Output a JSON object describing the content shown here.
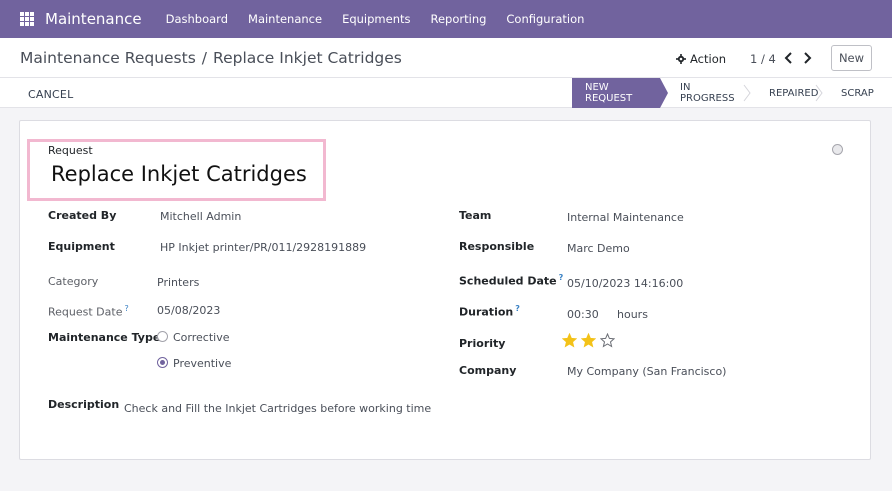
{
  "navbar": {
    "app_title": "Maintenance",
    "apps_icon": "grid-icon",
    "menu": [
      "Dashboard",
      "Maintenance",
      "Equipments",
      "Reporting",
      "Configuration"
    ]
  },
  "control_panel": {
    "breadcrumb_parent": "Maintenance Requests",
    "breadcrumb_separator": "/",
    "breadcrumb_current": "Replace Inkjet Catridges",
    "action_label": "Action",
    "pager": "1 / 4",
    "new_label": "New"
  },
  "statusbar": {
    "cancel_label": "CANCEL",
    "stages": [
      {
        "label": "NEW REQUEST",
        "active": true
      },
      {
        "label": "IN PROGRESS",
        "active": false
      },
      {
        "label": "REPAIRED",
        "active": false
      },
      {
        "label": "SCRAP",
        "active": false
      }
    ]
  },
  "form": {
    "request_label": "Request",
    "request_title": "Replace Inkjet Catridges",
    "left": {
      "created_by_label": "Created By",
      "created_by": "Mitchell Admin",
      "equipment_label": "Equipment",
      "equipment": "HP Inkjet printer/PR/011/2928191889",
      "category_label": "Category",
      "category": "Printers",
      "request_date_label": "Request Date",
      "request_date": "05/08/2023",
      "maintenance_type_label": "Maintenance Type",
      "types": [
        {
          "label": "Corrective",
          "checked": false
        },
        {
          "label": "Preventive",
          "checked": true
        }
      ]
    },
    "right": {
      "team_label": "Team",
      "team": "Internal Maintenance",
      "responsible_label": "Responsible",
      "responsible": "Marc Demo",
      "scheduled_date_label": "Scheduled Date",
      "scheduled_date": "05/10/2023 14:16:00",
      "duration_label": "Duration",
      "duration": "00:30",
      "duration_unit": "hours",
      "priority_label": "Priority",
      "priority_stars": 2,
      "priority_max": 3,
      "company_label": "Company",
      "company": "My Company (San Francisco)"
    },
    "help_marker": "?",
    "description_label": "Description",
    "description": "Check and Fill the Inkjet Cartridges before working time"
  },
  "colors": {
    "brand": "#71639e",
    "star": "#f3c219",
    "highlight": "#f2b8d0"
  }
}
